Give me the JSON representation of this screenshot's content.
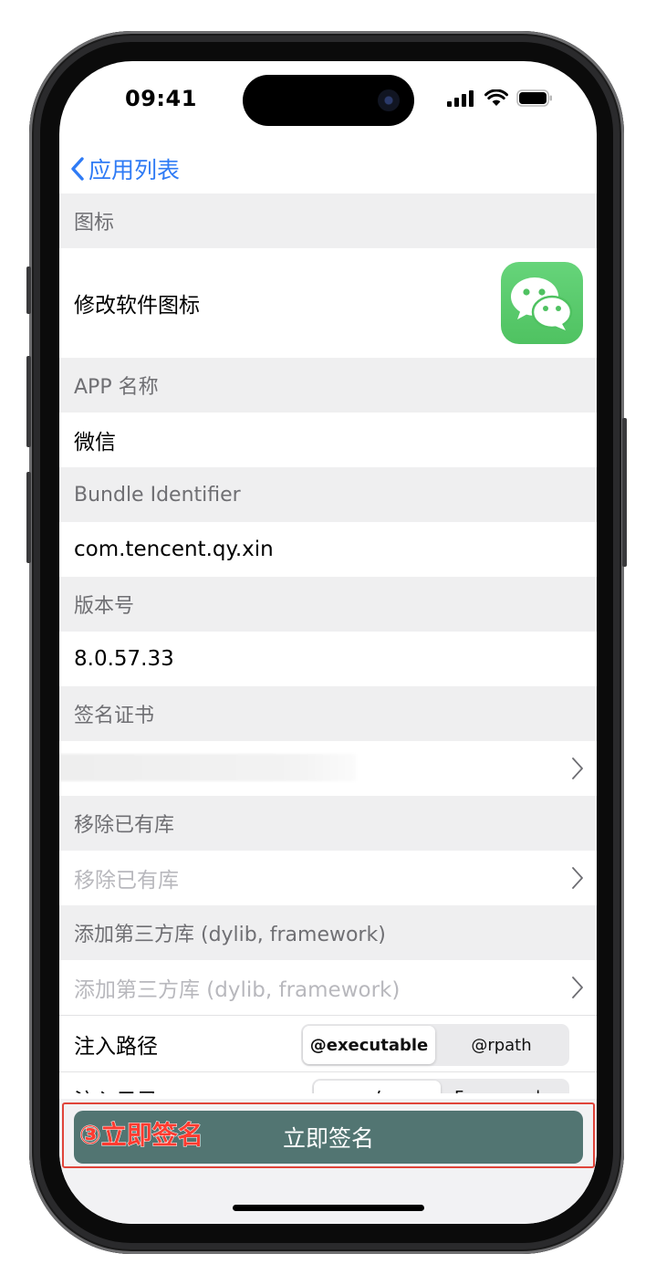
{
  "status_bar": {
    "time": "09:41"
  },
  "nav": {
    "back_label": "应用列表"
  },
  "sections": {
    "icon": {
      "header": "图标",
      "row_label": "修改软件图标"
    },
    "app_name": {
      "header": "APP 名称",
      "value": "微信"
    },
    "bundle_id": {
      "header": "Bundle Identifier",
      "value": "com.tencent.qy.xin"
    },
    "version": {
      "header": "版本号",
      "value": "8.0.57.33"
    },
    "certificate": {
      "header": "签名证书"
    },
    "remove_libs": {
      "header": "移除已有库",
      "placeholder": "移除已有库"
    },
    "add_libs": {
      "header": "添加第三方库 (dylib, framework)",
      "placeholder": "添加第三方库 (dylib, framework)"
    },
    "inject_path": {
      "label": "注入路径",
      "options": [
        "@executable",
        "@rpath"
      ],
      "selected": "@executable"
    },
    "inject_dir": {
      "label": "注入目录",
      "options": [
        "/",
        "Frameworks"
      ]
    }
  },
  "sign_button": {
    "label": "立即签名"
  },
  "annotation": {
    "text": "③立即签名",
    "color": "#ff3b30"
  },
  "colors": {
    "accent": "#2f7bf5",
    "button": "#527572",
    "app_icon": "#5ccb6e"
  }
}
